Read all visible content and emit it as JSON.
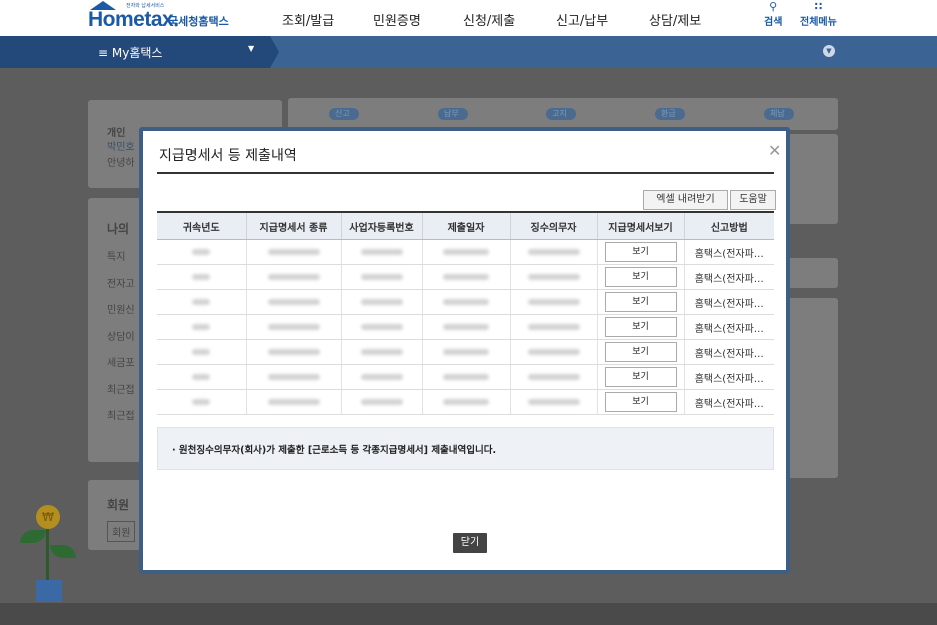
{
  "header": {
    "logo_tagline": "전자와 납세서비스",
    "logo_text": "Hometax.",
    "logo_kr": "국세청홈택스",
    "nav": [
      "조회/발급",
      "민원증명",
      "신청/제출",
      "신고/납부",
      "상담/제보"
    ],
    "search_label": "검색",
    "menu_label": "전체메뉴"
  },
  "subbar": {
    "my_label": "≡ My홈택스"
  },
  "background": {
    "pills": [
      "신고",
      "납부",
      "고지",
      "환급",
      "체납"
    ],
    "card1_title": "개인",
    "card1_name": "박민호",
    "card1_text": "안녕하",
    "card2_title": "나의",
    "card2_items": [
      "특지",
      "전자고",
      "민원신",
      "상담이",
      "세금포",
      "최근접",
      "최근접"
    ],
    "card3_title": "회원",
    "card3_text": "회원"
  },
  "modal": {
    "title": "지급명세서 등 제출내역",
    "excel_button": "엑셀 내려받기",
    "help_button": "도움말",
    "columns": [
      "귀속년도",
      "지급명세서 종류",
      "사업자등록번호",
      "제출일자",
      "징수의무자",
      "지급명세서보기",
      "신고방법"
    ],
    "rows": [
      {
        "view": "보기",
        "method": "홈택스(전자파…"
      },
      {
        "view": "보기",
        "method": "홈택스(전자파…"
      },
      {
        "view": "보기",
        "method": "홈택스(전자파…"
      },
      {
        "view": "보기",
        "method": "홈택스(전자파…"
      },
      {
        "view": "보기",
        "method": "홈택스(전자파…"
      },
      {
        "view": "보기",
        "method": "홈택스(전자파…"
      },
      {
        "view": "보기",
        "method": "홈택스(전자파…"
      }
    ],
    "note": "· 원천징수의무자(회사)가 제출한 [근로소득 등 각종지급명세서] 제출내역입니다.",
    "close_button": "닫기"
  }
}
